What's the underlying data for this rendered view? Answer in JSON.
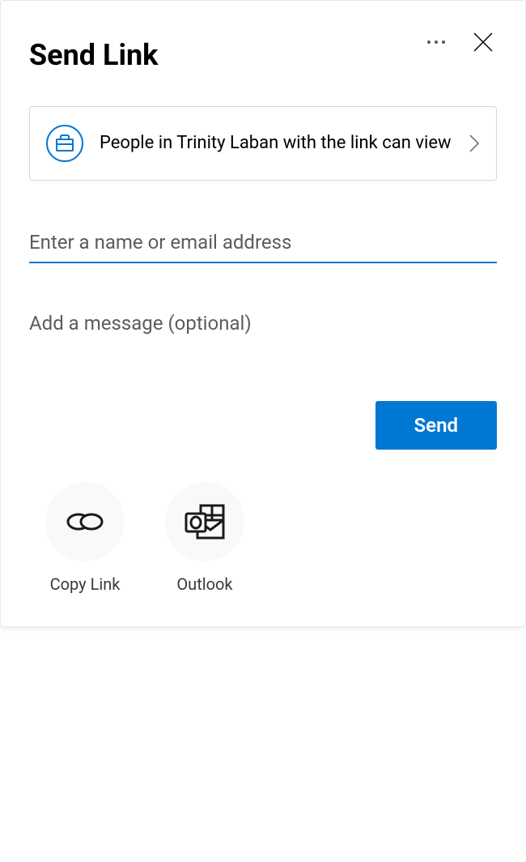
{
  "dialog": {
    "title": "Send Link",
    "settings": {
      "text": "People in Trinity Laban with the link can view"
    },
    "recipients": {
      "placeholder": "Enter a name or email address",
      "value": ""
    },
    "message": {
      "placeholder": "Add a message (optional)",
      "value": ""
    },
    "send_label": "Send",
    "share_options": {
      "copy_link": "Copy Link",
      "outlook": "Outlook"
    }
  }
}
